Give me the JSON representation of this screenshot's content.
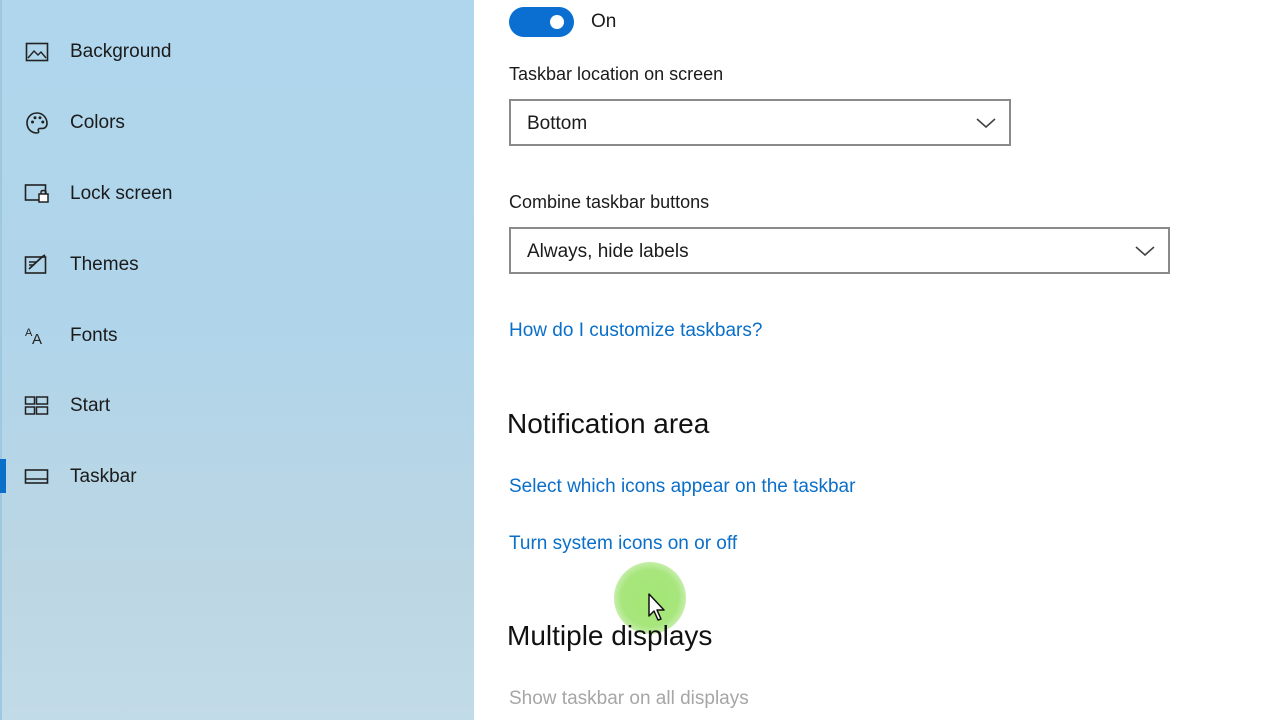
{
  "sidebar": {
    "items": [
      {
        "label": "Background",
        "icon": "picture-icon"
      },
      {
        "label": "Colors",
        "icon": "palette-icon"
      },
      {
        "label": "Lock screen",
        "icon": "lock-screen-icon"
      },
      {
        "label": "Themes",
        "icon": "themes-icon"
      },
      {
        "label": "Fonts",
        "icon": "fonts-icon"
      },
      {
        "label": "Start",
        "icon": "start-icon"
      },
      {
        "label": "Taskbar",
        "icon": "taskbar-icon"
      }
    ],
    "selected": "Taskbar"
  },
  "main": {
    "toggle": {
      "state_label": "On",
      "checked": true
    },
    "taskbar_location": {
      "label": "Taskbar location on screen",
      "value": "Bottom"
    },
    "combine_buttons": {
      "label": "Combine taskbar buttons",
      "value": "Always, hide labels"
    },
    "help_link": "How do I customize taskbars?",
    "notification_area": {
      "heading": "Notification area",
      "links": [
        "Select which icons appear on the taskbar",
        "Turn system icons on or off"
      ]
    },
    "multiple_displays": {
      "heading": "Multiple displays",
      "show_on_all": "Show taskbar on all displays"
    }
  },
  "colors": {
    "accent": "#0a6fc9",
    "sidebar_bg": "#afd6ec",
    "link": "#0a6fc9",
    "disabled_text": "#a6a6a6"
  }
}
